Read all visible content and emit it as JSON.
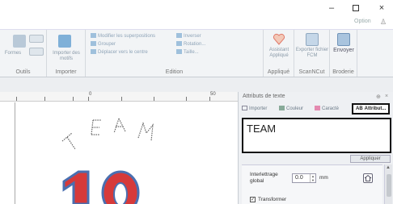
{
  "window": {
    "minimize": "–",
    "close": "×"
  },
  "ribbon": {
    "option_label": "Option",
    "groups": [
      {
        "label": "Outils",
        "buttons": [
          {
            "label": "Formes"
          }
        ]
      },
      {
        "label": "Importer",
        "buttons": [
          {
            "label": "Importer des motifs"
          }
        ]
      },
      {
        "label": "Edition",
        "items": [
          "Modifier les superpositions",
          "Grouper",
          "Déplacer vers le centre",
          "Inverser",
          "Rotation...",
          "Taille..."
        ]
      },
      {
        "label": "Appliqué",
        "buttons": [
          {
            "label": "Assistant Appliqué"
          }
        ]
      },
      {
        "label": "ScanNCut",
        "buttons": [
          {
            "label": "Exporter fichier FCM"
          }
        ]
      },
      {
        "label": "Broderie",
        "buttons": [
          {
            "label": "Envoyer"
          }
        ]
      }
    ]
  },
  "ruler": {
    "marks": [
      "0",
      "50"
    ]
  },
  "panel": {
    "title": "Attributs de texte",
    "pin": "⊕",
    "close": "×",
    "tabs": [
      {
        "label": "Importer",
        "icon": "import-icon"
      },
      {
        "label": "Couleur",
        "icon": "color-icon"
      },
      {
        "label": "Caractè",
        "icon": "character-icon"
      },
      {
        "label": "Attribut...",
        "icon": "ab-attribute-icon",
        "prefix": "AB",
        "active": true
      }
    ],
    "text_value": "TEAM",
    "apply_label": "Appliquer",
    "line_spacing_label_1": "Interlettrage",
    "line_spacing_label_2": "global",
    "line_spacing_value": "0.0",
    "line_spacing_unit": "mm",
    "transform_label": "Transformer",
    "transform_checked": "✓"
  },
  "colors": {
    "accent_red": "#d63a3a",
    "text_outline": "#4a6fb0"
  }
}
